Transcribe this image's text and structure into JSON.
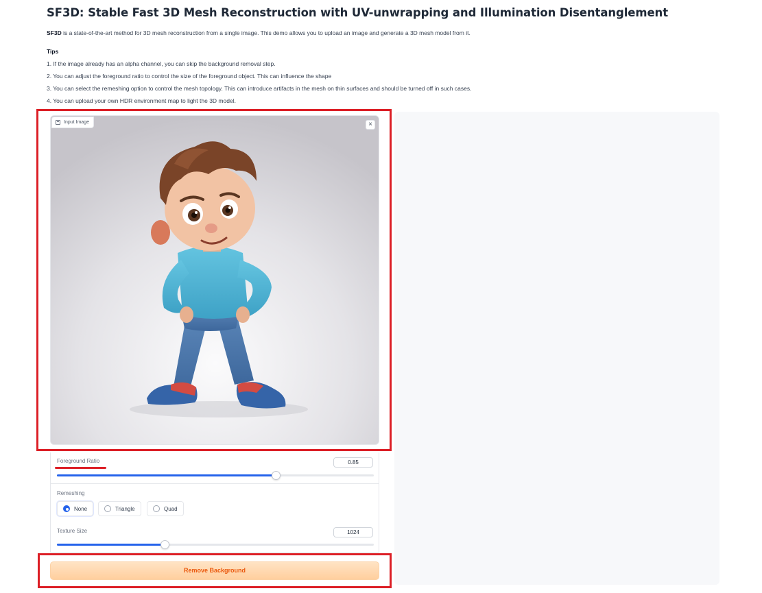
{
  "header": {
    "title": "SF3D: Stable Fast 3D Mesh Reconstruction with UV-unwrapping and Illumination Disentanglement",
    "intro_bold": "SF3D",
    "intro_rest": " is a state-of-the-art method for 3D mesh reconstruction from a single image. This demo allows you to upload an image and generate a 3D mesh model from it."
  },
  "tips": {
    "heading": "Tips",
    "items": [
      "1. If the image already has an alpha channel, you can skip the background removal step.",
      "2. You can adjust the foreground ratio to control the size of the foreground object. This can influence the shape",
      "3. You can select the remeshing option to control the mesh topology. This can introduce artifacts in the mesh on thin surfaces and should be turned off in such cases.",
      "4. You can upload your own HDR environment map to light the 3D model."
    ]
  },
  "input_image": {
    "label": "Input Image",
    "image_icon": "image-icon",
    "close_icon": "close-icon",
    "close_glyph": "×"
  },
  "controls": {
    "foreground_ratio": {
      "label": "Foreground Ratio",
      "value": "0.85",
      "fraction": 0.69
    },
    "remeshing": {
      "label": "Remeshing",
      "options": [
        "None",
        "Triangle",
        "Quad"
      ],
      "selected": "None"
    },
    "texture_size": {
      "label": "Texture Size",
      "value": "1024",
      "fraction": 0.34
    }
  },
  "actions": {
    "remove_background": "Remove Background"
  },
  "colors": {
    "accent": "#2563eb",
    "highlight_red": "#dc1f26",
    "button_text": "#ea580c",
    "button_bg": "#ffd9b0"
  }
}
